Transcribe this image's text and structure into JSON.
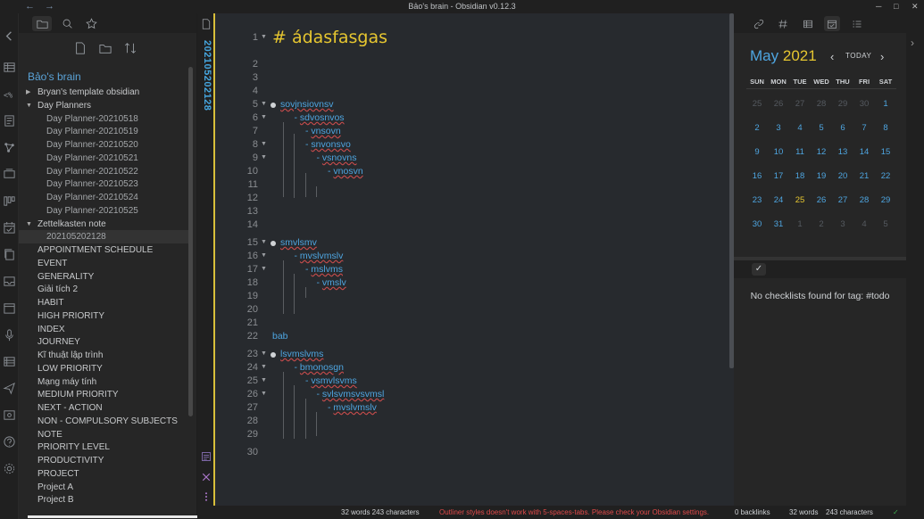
{
  "window": {
    "title": "Bảo's brain - Obsidian v0.12.3",
    "back": "←",
    "forward": "→",
    "minimize": "─",
    "maximize": "□",
    "close": "✕"
  },
  "explorer": {
    "vault_name": "Bảo's brain",
    "tree": [
      {
        "label": "Bryan's template obsidian",
        "level": 0,
        "type": "folder",
        "state": "collapsed"
      },
      {
        "label": "Day Planners",
        "level": 0,
        "type": "folder",
        "state": "expanded"
      },
      {
        "label": "Day Planner-20210518",
        "level": 1,
        "type": "file"
      },
      {
        "label": "Day Planner-20210519",
        "level": 1,
        "type": "file"
      },
      {
        "label": "Day Planner-20210520",
        "level": 1,
        "type": "file"
      },
      {
        "label": "Day Planner-20210521",
        "level": 1,
        "type": "file"
      },
      {
        "label": "Day Planner-20210522",
        "level": 1,
        "type": "file"
      },
      {
        "label": "Day Planner-20210523",
        "level": 1,
        "type": "file"
      },
      {
        "label": "Day Planner-20210524",
        "level": 1,
        "type": "file"
      },
      {
        "label": "Day Planner-20210525",
        "level": 1,
        "type": "file"
      },
      {
        "label": "Zettelkasten note",
        "level": 0,
        "type": "folder",
        "state": "expanded"
      },
      {
        "label": "202105202128",
        "level": 1,
        "type": "file",
        "selected": true
      },
      {
        "label": "APPOINTMENT SCHEDULE",
        "level": 0,
        "type": "note"
      },
      {
        "label": "EVENT",
        "level": 0,
        "type": "note"
      },
      {
        "label": "GENERALITY",
        "level": 0,
        "type": "note"
      },
      {
        "label": "Giải tích 2",
        "level": 0,
        "type": "note"
      },
      {
        "label": "HABIT",
        "level": 0,
        "type": "note"
      },
      {
        "label": "HIGH PRIORITY",
        "level": 0,
        "type": "note"
      },
      {
        "label": "INDEX",
        "level": 0,
        "type": "note"
      },
      {
        "label": "JOURNEY",
        "level": 0,
        "type": "note"
      },
      {
        "label": "Kĩ thuật lập trình",
        "level": 0,
        "type": "note"
      },
      {
        "label": "LOW PRIORITY",
        "level": 0,
        "type": "note"
      },
      {
        "label": "Mạng máy tính",
        "level": 0,
        "type": "note"
      },
      {
        "label": "MEDIUM PRIORITY",
        "level": 0,
        "type": "note"
      },
      {
        "label": "NEXT - ACTION",
        "level": 0,
        "type": "note"
      },
      {
        "label": "NON - COMPULSORY SUBJECTS",
        "level": 0,
        "type": "note"
      },
      {
        "label": "NOTE",
        "level": 0,
        "type": "note"
      },
      {
        "label": "PRIORITY LEVEL",
        "level": 0,
        "type": "note"
      },
      {
        "label": "PRODUCTIVITY",
        "level": 0,
        "type": "note"
      },
      {
        "label": "PROJECT",
        "level": 0,
        "type": "note"
      },
      {
        "label": "Project A",
        "level": 0,
        "type": "note"
      },
      {
        "label": "Project B",
        "level": 0,
        "type": "note"
      }
    ]
  },
  "editor": {
    "note_title": "202105202128",
    "heading_text": "# ádasfasgas",
    "lines": [
      {
        "n": "1",
        "fold": true,
        "kind": "heading"
      },
      {
        "n": "2"
      },
      {
        "n": "3"
      },
      {
        "n": "4"
      },
      {
        "n": "5",
        "fold": true,
        "kind": "item",
        "depth": 0,
        "text": "sovjnsiovnsv"
      },
      {
        "n": "6",
        "fold": true,
        "kind": "item",
        "depth": 1,
        "text": "sdvosnvos"
      },
      {
        "n": "7",
        "kind": "item",
        "depth": 2,
        "text": "vnsovn"
      },
      {
        "n": "8",
        "fold": true,
        "kind": "item",
        "depth": 2,
        "text": "snvonsvo"
      },
      {
        "n": "9",
        "fold": true,
        "kind": "item",
        "depth": 3,
        "text": "vsnovns"
      },
      {
        "n": "10",
        "kind": "item",
        "depth": 4,
        "text": "vnosvn"
      },
      {
        "n": "11"
      },
      {
        "n": "12"
      },
      {
        "n": "13"
      },
      {
        "n": "14"
      },
      {
        "n": "15",
        "fold": true,
        "kind": "item",
        "depth": 0,
        "text": "smvlsmv"
      },
      {
        "n": "16",
        "fold": true,
        "kind": "item",
        "depth": 1,
        "text": "mvslvmslv"
      },
      {
        "n": "17",
        "fold": true,
        "kind": "item",
        "depth": 2,
        "text": "mslvms"
      },
      {
        "n": "18",
        "kind": "item",
        "depth": 3,
        "text": "vmslv"
      },
      {
        "n": "19"
      },
      {
        "n": "20"
      },
      {
        "n": "21"
      },
      {
        "n": "22",
        "kind": "plain",
        "text": "bab"
      },
      {
        "n": "23",
        "fold": true,
        "kind": "item",
        "depth": 0,
        "text": "lsvmslvms"
      },
      {
        "n": "24",
        "fold": true,
        "kind": "item",
        "depth": 1,
        "text": "bmonosgn"
      },
      {
        "n": "25",
        "fold": true,
        "kind": "item",
        "depth": 2,
        "text": "vsmvlsvms"
      },
      {
        "n": "26",
        "fold": true,
        "kind": "item",
        "depth": 3,
        "text": "svlsvmsvsvmsl"
      },
      {
        "n": "27",
        "kind": "item",
        "depth": 4,
        "text": "mvslvmslv"
      },
      {
        "n": "28"
      },
      {
        "n": "29"
      },
      {
        "n": "30"
      }
    ]
  },
  "calendar": {
    "month": "May",
    "year": "2021",
    "today_label": "TODAY",
    "prev": "‹",
    "next": "›",
    "weekdays": [
      "SUN",
      "MON",
      "TUE",
      "WED",
      "THU",
      "FRI",
      "SAT"
    ],
    "weeks": [
      [
        {
          "d": "25",
          "dim": true
        },
        {
          "d": "26",
          "dim": true
        },
        {
          "d": "27",
          "dim": true
        },
        {
          "d": "28",
          "dim": true
        },
        {
          "d": "29",
          "dim": true
        },
        {
          "d": "30",
          "dim": true
        },
        {
          "d": "1"
        }
      ],
      [
        {
          "d": "2"
        },
        {
          "d": "3"
        },
        {
          "d": "4"
        },
        {
          "d": "5"
        },
        {
          "d": "6"
        },
        {
          "d": "7"
        },
        {
          "d": "8"
        }
      ],
      [
        {
          "d": "9"
        },
        {
          "d": "10"
        },
        {
          "d": "11"
        },
        {
          "d": "12"
        },
        {
          "d": "13"
        },
        {
          "d": "14"
        },
        {
          "d": "15"
        }
      ],
      [
        {
          "d": "16"
        },
        {
          "d": "17"
        },
        {
          "d": "18"
        },
        {
          "d": "19"
        },
        {
          "d": "20"
        },
        {
          "d": "21"
        },
        {
          "d": "22"
        }
      ],
      [
        {
          "d": "23"
        },
        {
          "d": "24"
        },
        {
          "d": "25",
          "today": true
        },
        {
          "d": "26"
        },
        {
          "d": "27"
        },
        {
          "d": "28"
        },
        {
          "d": "29"
        }
      ],
      [
        {
          "d": "30"
        },
        {
          "d": "31"
        },
        {
          "d": "1",
          "dim": true
        },
        {
          "d": "2",
          "dim": true
        },
        {
          "d": "3",
          "dim": true
        },
        {
          "d": "4",
          "dim": true
        },
        {
          "d": "5",
          "dim": true
        }
      ]
    ]
  },
  "checklist": {
    "tab_glyph": "✓",
    "empty_message": "No checklists found for tag: #todo"
  },
  "status": {
    "left_count": "32 words 243 characters",
    "warning": "Outliner styles doesn't work with 5-spaces-tabs. Please check your Obsidian settings.",
    "backlinks": "0 backlinks",
    "words": "32 words",
    "characters": "243 characters"
  },
  "colors": {
    "accent_blue": "#4ea5e0",
    "accent_gold": "#e6c630",
    "warning_red": "#e04a4a"
  }
}
